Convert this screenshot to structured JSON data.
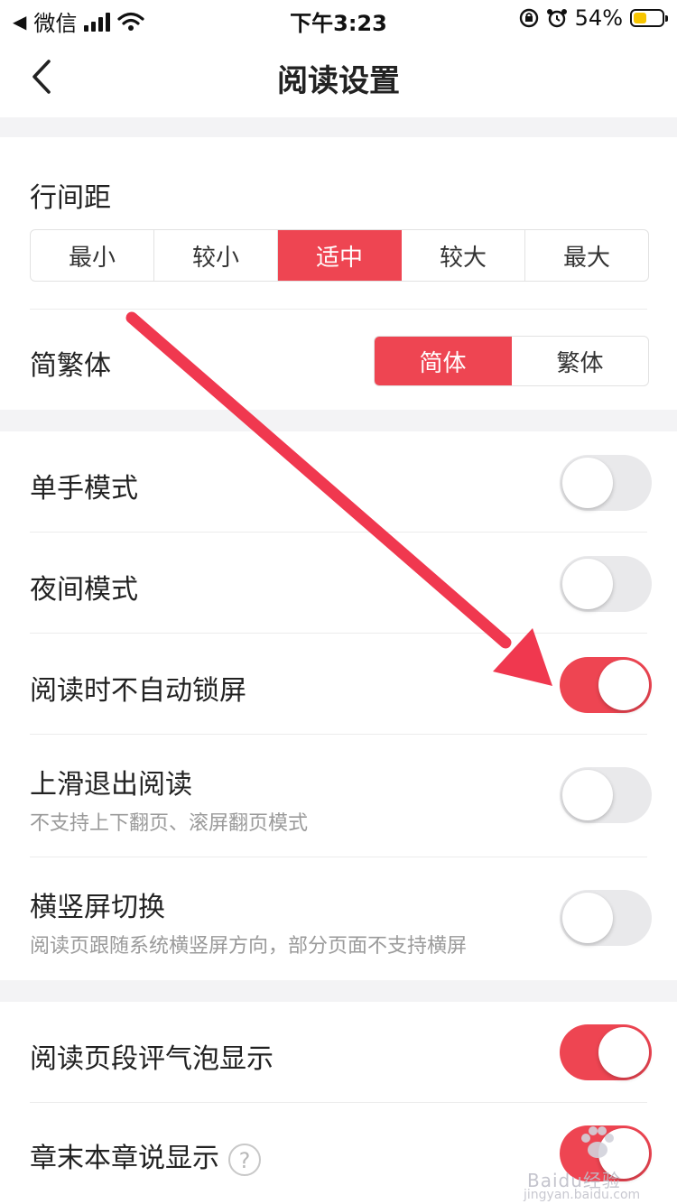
{
  "status_bar": {
    "back_app": "微信",
    "time": "下午3:23",
    "battery_text": "54%",
    "battery_level": 0.54
  },
  "nav": {
    "title": "阅读设置"
  },
  "line_spacing": {
    "label": "行间距",
    "options": [
      "最小",
      "较小",
      "适中",
      "较大",
      "最大"
    ],
    "selected": "适中"
  },
  "script_type": {
    "label": "简繁体",
    "options": [
      "简体",
      "繁体"
    ],
    "selected": "简体"
  },
  "toggles": [
    {
      "label": "单手模式",
      "on": false
    },
    {
      "label": "夜间模式",
      "on": false
    },
    {
      "label": "阅读时不自动锁屏",
      "on": true
    },
    {
      "label": "上滑退出阅读",
      "sublabel": "不支持上下翻页、滚屏翻页模式",
      "on": false
    },
    {
      "label": "横竖屏切换",
      "sublabel": "阅读页跟随系统横竖屏方向，部分页面不支持横屏",
      "on": false
    }
  ],
  "toggles_2": [
    {
      "label": "阅读页段评气泡显示",
      "on": true
    },
    {
      "label": "章末本章说显示",
      "help": "?",
      "on": true
    }
  ],
  "watermark": {
    "brand": "Baidu经验",
    "site": "jingyan.baidu.com"
  },
  "colors": {
    "accent": "#ee4552",
    "annotation_arrow": "#f0384f",
    "toggle_off": "#e9e9eb"
  }
}
